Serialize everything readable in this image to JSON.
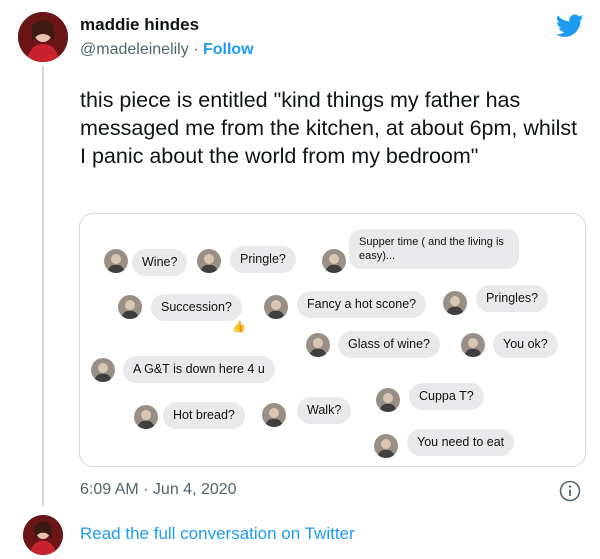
{
  "user": {
    "display_name": "maddie hindes",
    "handle": "@madeleinelily",
    "separator": " · ",
    "follow_label": "Follow"
  },
  "tweet": {
    "text": "this piece is entitled \"kind things my father has messaged me from the kitchen, at about 6pm, whilst I panic about the world from my bedroom\"",
    "timestamp": "6:09 AM · Jun 4, 2020"
  },
  "messages": [
    {
      "text": "Wine?"
    },
    {
      "text": "Pringle?"
    },
    {
      "text": "Supper time ( and the living is easy)..."
    },
    {
      "text": "Succession?"
    },
    {
      "text": "Fancy a hot scone?"
    },
    {
      "text": "Pringles?"
    },
    {
      "text": "Glass of wine?"
    },
    {
      "text": "You ok?"
    },
    {
      "text": "A G&T is down here 4 u"
    },
    {
      "text": "Cuppa T?"
    },
    {
      "text": "Hot bread?"
    },
    {
      "text": "Walk?"
    },
    {
      "text": "You need to eat"
    }
  ],
  "thumbs_up_emoji": "👍",
  "footer": {
    "read_more": "Read the full conversation on Twitter"
  },
  "icons": [
    "twitter-bird-icon",
    "info-icon",
    "thumbs-up-icon"
  ],
  "colors": {
    "accent": "#1d9bf0",
    "bubble": "#e9e9eb",
    "text": "#0f1419",
    "muted": "#536471"
  }
}
